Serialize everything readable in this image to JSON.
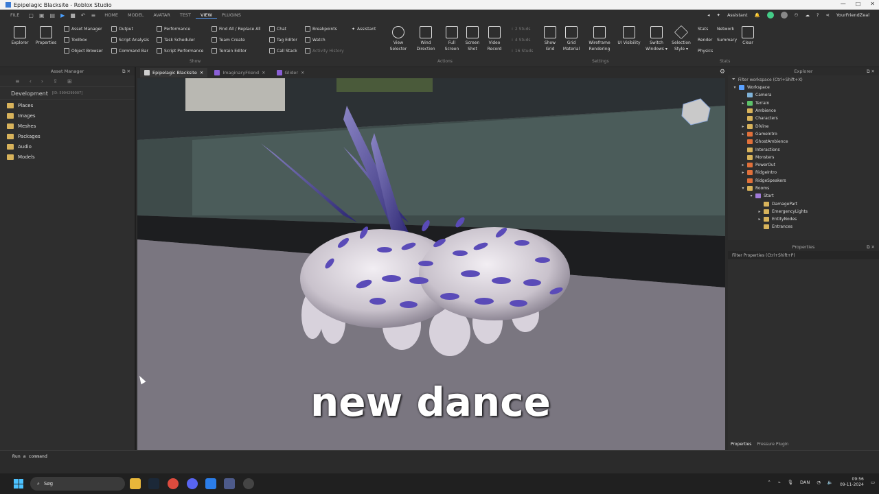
{
  "window": {
    "title": "Epipelagic Blacksite - Roblox Studio",
    "controls": [
      "—",
      "□",
      "✕"
    ]
  },
  "menubar": {
    "items": [
      "FILE",
      "HOME",
      "MODEL",
      "AVATAR",
      "TEST",
      "VIEW",
      "PLUGINS"
    ],
    "active": "VIEW",
    "assistant": "Assistant",
    "user": "YourFriendZeal"
  },
  "ribbon": {
    "big": [
      {
        "label": "Explorer",
        "icon": "explorer-icon"
      },
      {
        "label": "Properties",
        "icon": "properties-icon"
      }
    ],
    "show_col1": [
      "Asset Manager",
      "Toolbox",
      "Object Browser"
    ],
    "show_col2": [
      "Output",
      "Script Analysis",
      "Command Bar"
    ],
    "show_col3": [
      "Performance",
      "Task Scheduler",
      "Script Performance"
    ],
    "show_col4": [
      "Find All / Replace All",
      "Team Create",
      "Terrain Editor"
    ],
    "show_col5": [
      "Chat",
      "Tag Editor",
      "Call Stack"
    ],
    "show_col6": [
      "Breakpoints",
      "Watch",
      "Activity History"
    ],
    "show_col7": [
      "Assistant"
    ],
    "show_group": "Show",
    "actions": [
      {
        "label1": "View",
        "label2": "Selector"
      },
      {
        "label1": "Wind",
        "label2": "Direction"
      },
      {
        "label1": "Full",
        "label2": "Screen"
      },
      {
        "label1": "Screen",
        "label2": "Shot"
      },
      {
        "label1": "Video",
        "label2": "Record"
      }
    ],
    "actions_group": "Actions",
    "studs": [
      "2 Studs",
      "4 Studs",
      "16 Studs"
    ],
    "settings": [
      {
        "label1": "Show",
        "label2": "Grid"
      },
      {
        "label1": "Grid",
        "label2": "Material"
      },
      {
        "label1": "Wireframe",
        "label2": "Rendering"
      },
      {
        "label1": "UI Visibility",
        "label2": ""
      },
      {
        "label1": "Switch",
        "label2": "Windows ▾"
      },
      {
        "label1": "Selection",
        "label2": "Style ▾"
      }
    ],
    "settings_group": "Settings",
    "stats": [
      "Stats",
      "Render",
      "Physics"
    ],
    "stats2": [
      "Network",
      "Summary"
    ],
    "clear": "Clear",
    "stats_group": "Stats"
  },
  "asset_manager": {
    "title": "Asset Manager",
    "section": "Development",
    "section_id": "[ID: 5994299007]",
    "items": [
      "Places",
      "Images",
      "Meshes",
      "Packages",
      "Audio",
      "Models"
    ]
  },
  "tabs": [
    {
      "label": "Epipelagic Blacksite",
      "active": true,
      "color": "#d0d0d0"
    },
    {
      "label": "ImaginaryFriend",
      "active": false,
      "color": "#8a5fd6"
    },
    {
      "label": "Glider",
      "active": false,
      "color": "#8a5fd6"
    }
  ],
  "explorer": {
    "title": "Explorer",
    "filter": "Filter workspace (Ctrl+Shift+X)",
    "tree": [
      {
        "label": "Workspace",
        "depth": 0,
        "arrow": "▾",
        "color": "#5aa1ff"
      },
      {
        "label": "Camera",
        "depth": 1,
        "arrow": "",
        "color": "#7fb2d8"
      },
      {
        "label": "Terrain",
        "depth": 1,
        "arrow": "▸",
        "color": "#5ec26a"
      },
      {
        "label": "Ambience",
        "depth": 1,
        "arrow": "",
        "color": "#d8b35b"
      },
      {
        "label": "Characters",
        "depth": 1,
        "arrow": "",
        "color": "#d8b35b"
      },
      {
        "label": "DiVine",
        "depth": 1,
        "arrow": "▸",
        "color": "#d8b35b"
      },
      {
        "label": "GameIntro",
        "depth": 1,
        "arrow": "▸",
        "color": "#e0703a"
      },
      {
        "label": "GhostAmbience",
        "depth": 1,
        "arrow": "",
        "color": "#e0703a"
      },
      {
        "label": "Interactions",
        "depth": 1,
        "arrow": "",
        "color": "#d8b35b"
      },
      {
        "label": "Monsters",
        "depth": 1,
        "arrow": "",
        "color": "#d8b35b"
      },
      {
        "label": "PowerOut",
        "depth": 1,
        "arrow": "▸",
        "color": "#e0703a"
      },
      {
        "label": "RidgeIntro",
        "depth": 1,
        "arrow": "▸",
        "color": "#e0703a"
      },
      {
        "label": "RidgeSpeakers",
        "depth": 1,
        "arrow": "",
        "color": "#e0703a"
      },
      {
        "label": "Rooms",
        "depth": 1,
        "arrow": "▾",
        "color": "#d8b35b"
      },
      {
        "label": "Start",
        "depth": 2,
        "arrow": "▾",
        "color": "#a07ad8"
      },
      {
        "label": "DamagePart",
        "depth": 3,
        "arrow": "",
        "color": "#d8b35b"
      },
      {
        "label": "EmergencyLights",
        "depth": 3,
        "arrow": "▸",
        "color": "#d8b35b"
      },
      {
        "label": "EntityNodes",
        "depth": 3,
        "arrow": "▸",
        "color": "#d8b35b"
      },
      {
        "label": "Entrances",
        "depth": 3,
        "arrow": "",
        "color": "#d8b35b"
      }
    ]
  },
  "properties": {
    "title": "Properties",
    "filter": "Filter Properties (Ctrl+Shift+P)",
    "tabs": [
      "Properties",
      "Pressure Plugin"
    ]
  },
  "command_bar": {
    "placeholder": "Run a command"
  },
  "caption": "new dance",
  "taskbar": {
    "search": "Søg",
    "lang": "DAN",
    "time": "09:56",
    "date": "09-11-2024"
  }
}
